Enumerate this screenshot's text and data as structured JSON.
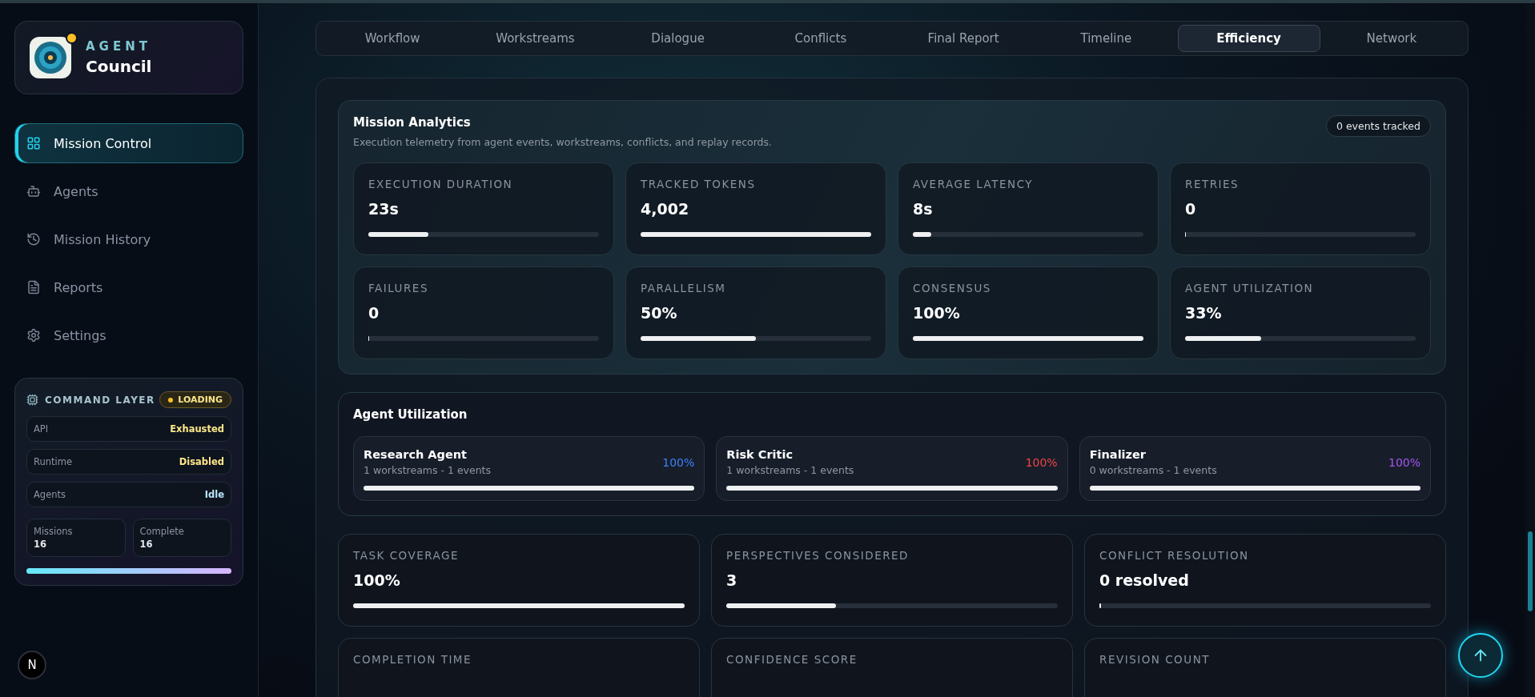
{
  "brand": {
    "kicker": "AGENT",
    "title": "Council",
    "notification": true
  },
  "nav": [
    {
      "label": "Mission Control",
      "selected": true
    },
    {
      "label": "Agents",
      "selected": false
    },
    {
      "label": "Mission History",
      "selected": false
    },
    {
      "label": "Reports",
      "selected": false
    },
    {
      "label": "Settings",
      "selected": false
    }
  ],
  "command_layer": {
    "title": "COMMAND LAYER",
    "status": "LOADING",
    "rows": [
      {
        "label": "API",
        "value": "Exhausted",
        "color": "#fde68a"
      },
      {
        "label": "Runtime",
        "value": "Disabled",
        "color": "#fde68a"
      },
      {
        "label": "Agents",
        "value": "Idle",
        "color": "#bae6fd"
      }
    ],
    "stats": [
      {
        "label": "Missions",
        "value": "16"
      },
      {
        "label": "Complete",
        "value": "16"
      }
    ],
    "level": 1
  },
  "footer_badge": "N",
  "tabs": [
    {
      "label": "Workflow",
      "selected": false
    },
    {
      "label": "Workstreams",
      "selected": false
    },
    {
      "label": "Dialogue",
      "selected": false
    },
    {
      "label": "Conflicts",
      "selected": false
    },
    {
      "label": "Final Report",
      "selected": false
    },
    {
      "label": "Timeline",
      "selected": false
    },
    {
      "label": "Efficiency",
      "selected": true
    },
    {
      "label": "Network",
      "selected": false
    }
  ],
  "analytics": {
    "title": "Mission Analytics",
    "subtitle": "Execution telemetry from agent events, workstreams, conflicts, and replay records.",
    "badge": "0 events tracked",
    "metrics": [
      {
        "label": "EXECUTION DURATION",
        "value": "23s",
        "level": 0.26
      },
      {
        "label": "TRACKED TOKENS",
        "value": "4,002",
        "level": 1
      },
      {
        "label": "AVERAGE LATENCY",
        "value": "8s",
        "level": 0.08
      },
      {
        "label": "RETRIES",
        "value": "0",
        "level": 0.005
      },
      {
        "label": "FAILURES",
        "value": "0",
        "level": 0.004
      },
      {
        "label": "PARALLELISM",
        "value": "50%",
        "level": 0.5
      },
      {
        "label": "CONSENSUS",
        "value": "100%",
        "level": 1
      },
      {
        "label": "AGENT UTILIZATION",
        "value": "33%",
        "level": 0.33
      }
    ]
  },
  "agent_utilization": {
    "title": "Agent Utilization",
    "agents": [
      {
        "name": "Research Agent",
        "detail": "1 workstreams - 1 events",
        "percent": "100%",
        "color": "#3b82f6",
        "level": 1
      },
      {
        "name": "Risk Critic",
        "detail": "1 workstreams - 1 events",
        "percent": "100%",
        "color": "#ef4444",
        "level": 1
      },
      {
        "name": "Finalizer",
        "detail": "0 workstreams - 1 events",
        "percent": "100%",
        "color": "#a855f7",
        "level": 1
      }
    ]
  },
  "outcomes": [
    {
      "label": "TASK COVERAGE",
      "value": "100%",
      "level": 1
    },
    {
      "label": "PERSPECTIVES CONSIDERED",
      "value": "3",
      "level": 0.33
    },
    {
      "label": "CONFLICT RESOLUTION",
      "value": "0 resolved",
      "level": 0.005
    },
    {
      "label": "COMPLETION TIME"
    },
    {
      "label": "CONFIDENCE SCORE"
    },
    {
      "label": "REVISION COUNT"
    }
  ]
}
